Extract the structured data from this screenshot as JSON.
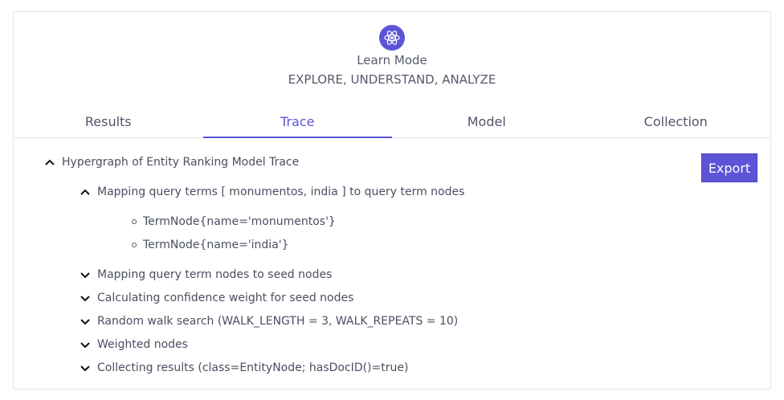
{
  "header": {
    "logo_icon": "atom-icon",
    "title": "Learn Mode",
    "subtitle": "EXPLORE, UNDERSTAND, ANALYZE"
  },
  "tabs": [
    {
      "label": "Results",
      "active": false
    },
    {
      "label": "Trace",
      "active": true
    },
    {
      "label": "Model",
      "active": false
    },
    {
      "label": "Collection",
      "active": false
    }
  ],
  "toolbar": {
    "export_label": "Export"
  },
  "trace": {
    "root": {
      "label": "Hypergraph of Entity Ranking Model Trace",
      "expanded": true
    },
    "steps": [
      {
        "label": "Mapping query terms [ monumentos, india ] to query term nodes",
        "expanded": true,
        "children": [
          "TermNode{name='monumentos'}",
          "TermNode{name='india'}"
        ]
      },
      {
        "label": "Mapping query term nodes to seed nodes",
        "expanded": false
      },
      {
        "label": "Calculating confidence weight for seed nodes",
        "expanded": false
      },
      {
        "label": "Random walk search (WALK_LENGTH = 3, WALK_REPEATS = 10)",
        "expanded": false
      },
      {
        "label": "Weighted nodes",
        "expanded": false
      },
      {
        "label": "Collecting results (class=EntityNode; hasDocID()=true)",
        "expanded": false
      }
    ]
  },
  "colors": {
    "accent": "#5b54d6",
    "text": "#4a4f60",
    "border": "#e3e5ea"
  }
}
